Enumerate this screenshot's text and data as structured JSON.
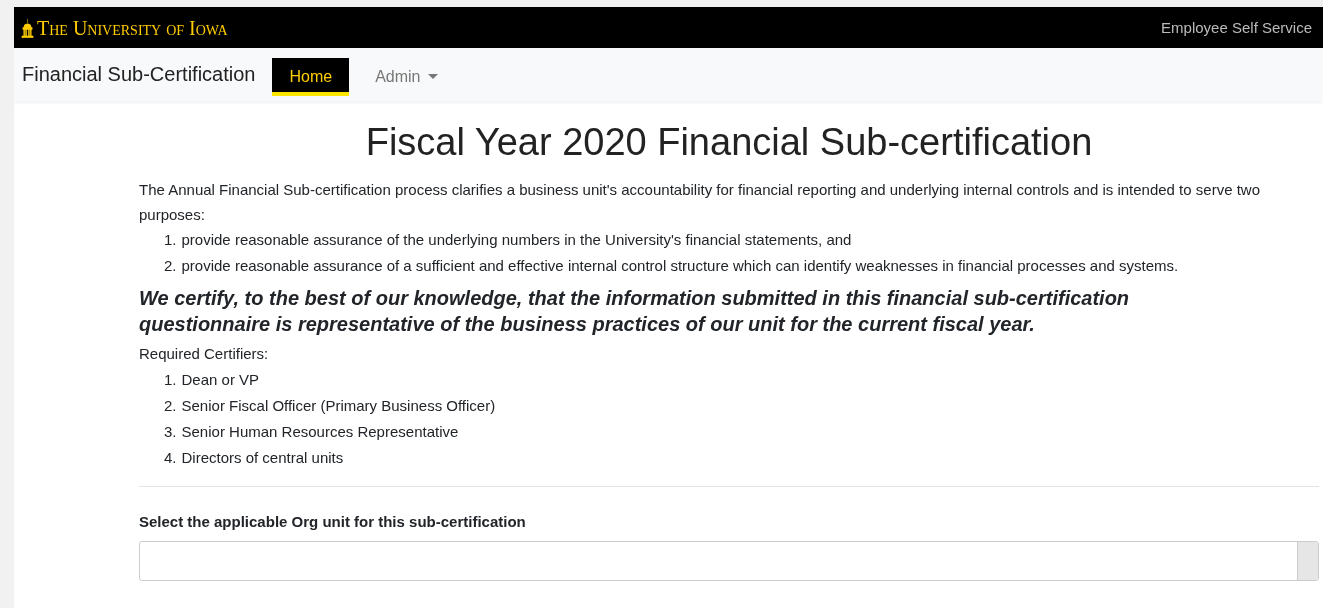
{
  "header": {
    "logo": "The University of Iowa",
    "link": "Employee Self Service"
  },
  "navbar": {
    "brand": "Financial Sub-Certification",
    "tabs": [
      {
        "label": "Home",
        "selected": true,
        "dropdown": false
      },
      {
        "label": "Admin",
        "selected": false,
        "dropdown": true
      }
    ]
  },
  "main": {
    "title": "Fiscal Year 2020 Financial Sub-certification",
    "intro": "The Annual Financial Sub-certification process clarifies a business unit's accountability for financial reporting and underlying internal controls and is intended to serve two purposes:",
    "purposes": [
      {
        "number": "1.",
        "text": "provide reasonable assurance of the underlying numbers in the University's financial statements, and"
      },
      {
        "number": "2.",
        "text": "provide reasonable assurance of a sufficient and effective internal control structure which can identify weaknesses in financial processes and systems."
      }
    ],
    "statement": "We certify, to the best of our knowledge, that the information submitted in this financial sub-certification questionnaire is representative of the business practices of our unit for the current fiscal year.",
    "certifiers_label": "Required Certifiers:",
    "certifiers": [
      {
        "number": "1.",
        "text": "Dean or VP"
      },
      {
        "number": "2.",
        "text": "Senior Fiscal Officer (Primary Business Officer)"
      },
      {
        "number": "3.",
        "text": "Senior Human Resources Representative"
      },
      {
        "number": "4.",
        "text": "Directors of central units"
      }
    ],
    "select_label": "Select the applicable Org unit for this sub-certification"
  }
}
